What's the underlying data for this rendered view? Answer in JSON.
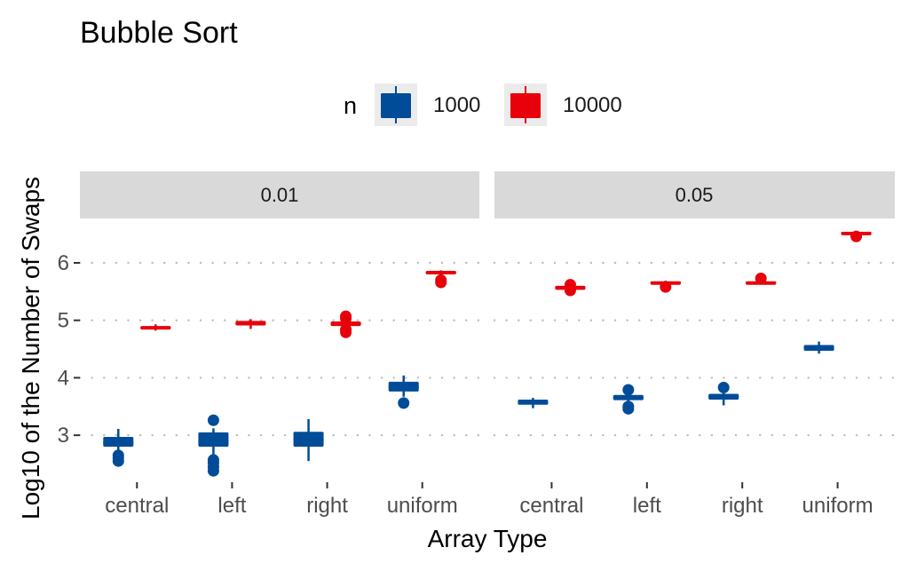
{
  "chart_data": {
    "type": "boxplot",
    "title": "Bubble Sort",
    "xlabel": "Array Type",
    "ylabel": "Log10 of the Number of Swaps",
    "ylim": [
      2.3,
      6.6
    ],
    "yticks": [
      3,
      4,
      5,
      6
    ],
    "grid": "horizontal dotted",
    "legend": {
      "title": "n",
      "position": "top",
      "entries": [
        {
          "label": "1000",
          "color": "#004C99"
        },
        {
          "label": "10000",
          "color": "#E8000B"
        }
      ]
    },
    "categories": [
      "central",
      "left",
      "right",
      "uniform"
    ],
    "facets": [
      {
        "label": "0.01",
        "series": [
          {
            "name": "1000",
            "boxes": [
              {
                "category": "central",
                "whisker_low": 2.73,
                "q1": 2.8,
                "median": 2.87,
                "q3": 2.97,
                "whisker_high": 3.11,
                "outliers": [
                  2.55,
                  2.6,
                  2.65
                ]
              },
              {
                "category": "left",
                "whisker_low": 2.6,
                "q1": 2.8,
                "median": 2.9,
                "q3": 3.05,
                "whisker_high": 3.12,
                "outliers": [
                  3.26,
                  2.38,
                  2.45,
                  2.52,
                  2.57
                ]
              },
              {
                "category": "right",
                "whisker_low": 2.55,
                "q1": 2.8,
                "median": 2.93,
                "q3": 3.06,
                "whisker_high": 3.28,
                "outliers": []
              },
              {
                "category": "uniform",
                "whisker_low": 3.67,
                "q1": 3.76,
                "median": 3.84,
                "q3": 3.93,
                "whisker_high": 4.04,
                "outliers": [
                  3.56
                ]
              }
            ]
          },
          {
            "name": "10000",
            "boxes": [
              {
                "category": "central",
                "whisker_low": 4.82,
                "q1": 4.84,
                "median": 4.87,
                "q3": 4.9,
                "whisker_high": 4.93,
                "outliers": []
              },
              {
                "category": "left",
                "whisker_low": 4.85,
                "q1": 4.91,
                "median": 4.95,
                "q3": 4.99,
                "whisker_high": 5.02,
                "outliers": []
              },
              {
                "category": "right",
                "whisker_low": 4.86,
                "q1": 4.9,
                "median": 4.94,
                "q3": 4.98,
                "whisker_high": 5.02,
                "outliers": [
                  5.07,
                  5.03,
                  4.84,
                  4.79
                ]
              },
              {
                "category": "uniform",
                "whisker_low": 5.79,
                "q1": 5.8,
                "median": 5.83,
                "q3": 5.86,
                "whisker_high": 5.87,
                "outliers": [
                  5.7,
                  5.66
                ]
              }
            ]
          }
        ]
      },
      {
        "label": "0.05",
        "series": [
          {
            "name": "1000",
            "boxes": [
              {
                "category": "central",
                "whisker_low": 3.47,
                "q1": 3.53,
                "median": 3.57,
                "q3": 3.62,
                "whisker_high": 3.65,
                "outliers": []
              },
              {
                "category": "left",
                "whisker_low": 3.56,
                "q1": 3.61,
                "median": 3.65,
                "q3": 3.7,
                "whisker_high": 3.74,
                "outliers": [
                  3.79,
                  3.5,
                  3.46
                ]
              },
              {
                "category": "right",
                "whisker_low": 3.52,
                "q1": 3.62,
                "median": 3.67,
                "q3": 3.72,
                "whisker_high": 3.75,
                "outliers": [
                  3.83
                ]
              },
              {
                "category": "uniform",
                "whisker_low": 4.42,
                "q1": 4.47,
                "median": 4.52,
                "q3": 4.57,
                "whisker_high": 4.63,
                "outliers": []
              }
            ]
          },
          {
            "name": "10000",
            "boxes": [
              {
                "category": "central",
                "whisker_low": 5.53,
                "q1": 5.53,
                "median": 5.57,
                "q3": 5.6,
                "whisker_high": 5.6,
                "outliers": [
                  5.52,
                  5.62
                ]
              },
              {
                "category": "left",
                "whisker_low": 5.63,
                "q1": 5.64,
                "median": 5.66,
                "q3": 5.68,
                "whisker_high": 5.69,
                "outliers": [
                  5.58
                ]
              },
              {
                "category": "right",
                "whisker_low": 5.63,
                "q1": 5.64,
                "median": 5.66,
                "q3": 5.68,
                "whisker_high": 5.69,
                "outliers": [
                  5.73
                ]
              },
              {
                "category": "uniform",
                "whisker_low": 6.5,
                "q1": 6.5,
                "median": 6.52,
                "q3": 6.54,
                "whisker_high": 6.55,
                "outliers": [
                  6.46
                ]
              }
            ]
          }
        ]
      }
    ]
  }
}
